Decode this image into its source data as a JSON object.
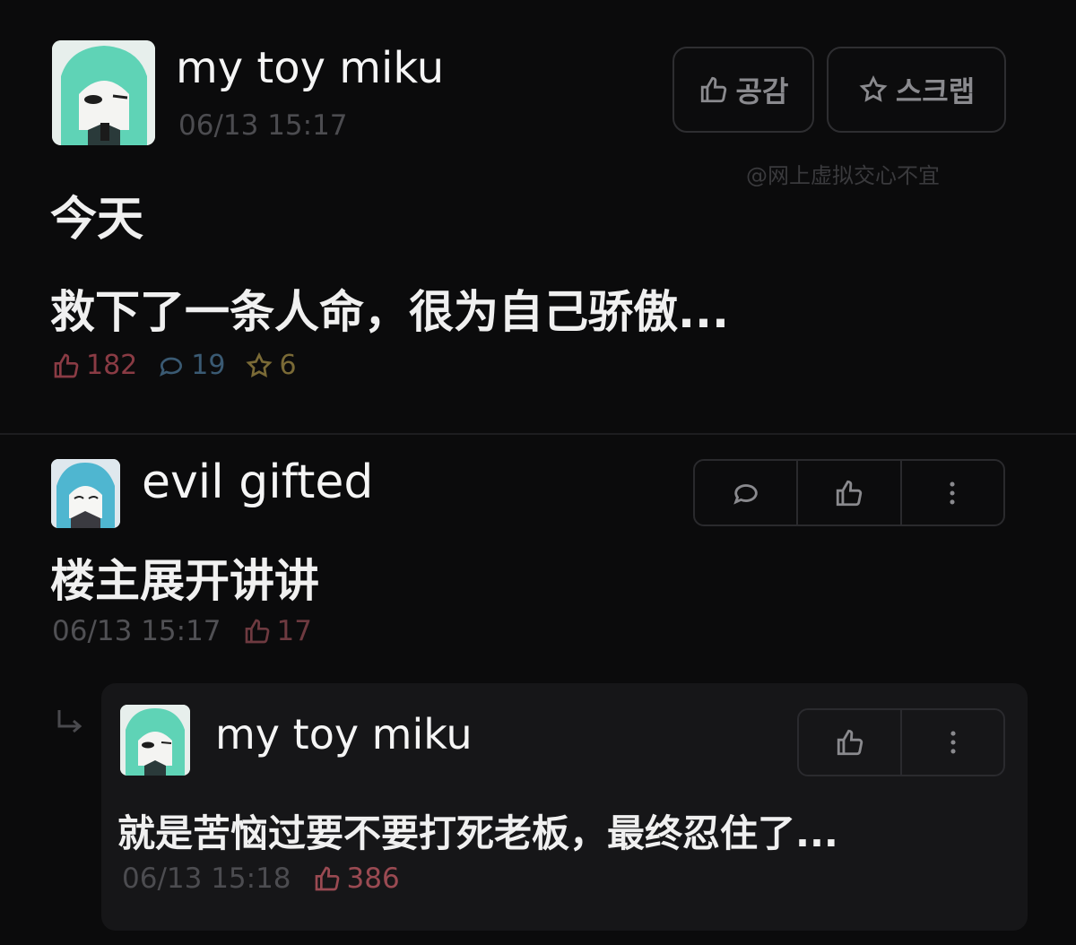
{
  "post": {
    "author": "my toy miku",
    "timestamp": "06/13 15:17",
    "buttons": {
      "like_label": "공감",
      "scrap_label": "스크랩"
    },
    "watermark": "@网上虚拟交心不宜",
    "title": "今天",
    "body": "救下了一条人命，很为自己骄傲...",
    "stats": {
      "likes": "182",
      "comments": "19",
      "scraps": "6"
    }
  },
  "comment": {
    "author": "evil gifted",
    "text": "楼主展开讲讲",
    "timestamp": "06/13 15:17",
    "likes": "17"
  },
  "reply": {
    "author": "my toy miku",
    "text": "就是苦恼过要不要打死老板，最终忍住了...",
    "timestamp": "06/13 15:18",
    "likes": "386"
  },
  "icons": {
    "like": "thumbs-up-icon",
    "scrap": "star-icon",
    "comment": "speech-bubble-icon",
    "more": "more-vertical-icon",
    "reply": "reply-arrow-icon"
  },
  "colors": {
    "background": "#0b0b0c",
    "like_accent": "#8a3b44",
    "comment_accent": "#3a5a73",
    "scrap_accent": "#7a6a36",
    "reply_like": "#9a4a52"
  }
}
